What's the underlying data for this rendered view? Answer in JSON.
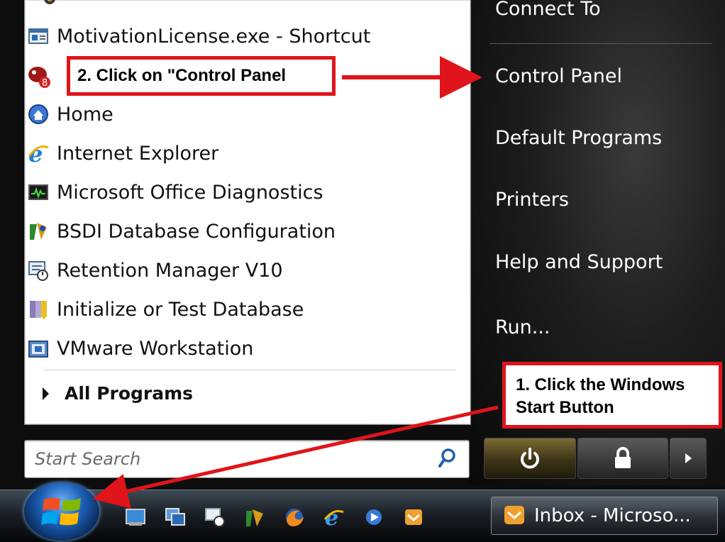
{
  "start_menu": {
    "left_items": [
      {
        "label": "MotivationLicense.exe - Shortcut",
        "icon": "shortcut-app-icon"
      },
      {
        "label": "",
        "icon": "recent-app-badge-icon",
        "badge": "8"
      },
      {
        "label": "Home",
        "icon": "home-icon"
      },
      {
        "label": "Internet Explorer",
        "icon": "internet-explorer-icon"
      },
      {
        "label": "Microsoft Office Diagnostics",
        "icon": "office-diagnostics-icon"
      },
      {
        "label": "BSDI Database Configuration",
        "icon": "bsdi-config-icon"
      },
      {
        "label": "Retention Manager V10",
        "icon": "retention-manager-icon"
      },
      {
        "label": "Initialize or Test Database",
        "icon": "database-icon"
      },
      {
        "label": "VMware Workstation",
        "icon": "vmware-icon"
      }
    ],
    "all_programs": "All Programs",
    "search_placeholder": "Start Search",
    "right_items": [
      "Connect To",
      "Control Panel",
      "Default Programs",
      "Printers",
      "Help and Support",
      "Run..."
    ]
  },
  "taskbar": {
    "quick_launch_icons": [
      "show-desktop-icon",
      "switch-windows-icon",
      "retention-manager-icon",
      "bsdi-icon",
      "firefox-icon",
      "internet-explorer-icon",
      "media-icon",
      "outlook-icon"
    ],
    "window_button": "Inbox - Microso..."
  },
  "annotations": {
    "step2": "2. Click on \"Control Panel",
    "step1_line1": "1. Click the Windows",
    "step1_line2": "Start Button"
  },
  "colors": {
    "annotation_red": "#e0141b",
    "panel_dark": "#1c1c1c"
  }
}
